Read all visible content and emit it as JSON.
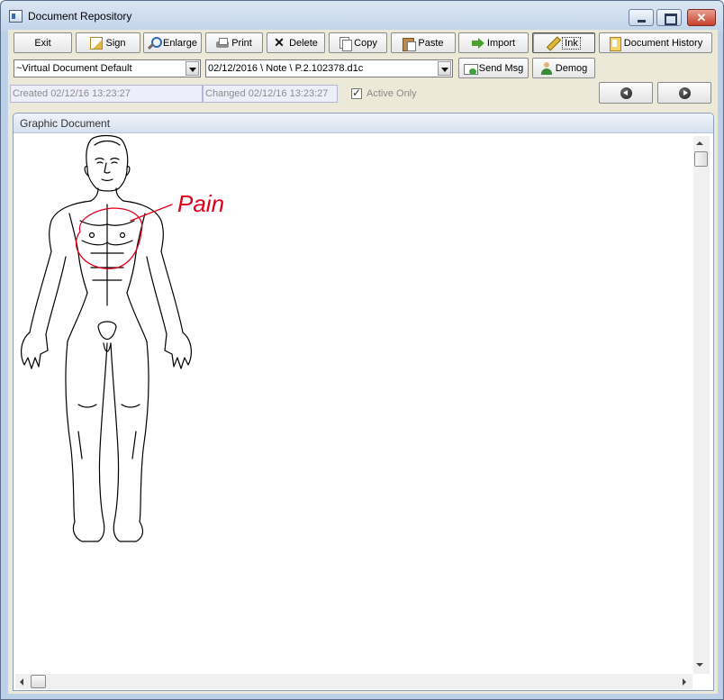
{
  "window": {
    "title": "Document Repository",
    "app_icon": "document-repository-icon"
  },
  "toolbar": {
    "exit": "Exit",
    "sign": "Sign",
    "enlarge": "Enlarge",
    "print": "Print",
    "delete": "Delete",
    "copy": "Copy",
    "paste": "Paste",
    "import": "Import",
    "ink": "Ink",
    "document_history": "Document History",
    "send_msg": "Send Msg",
    "demog": "Demog"
  },
  "selectors": {
    "template_value": "~Virtual Document Default",
    "document_value": "02/12/2016 \\ Note \\ P.2.102378.d1c"
  },
  "stamps": {
    "created": "Created 02/12/16 13:23:27",
    "changed": "Changed 02/12/16 13:23:27"
  },
  "filter": {
    "active_only_label": "Active Only",
    "active_only_checked": true
  },
  "panel": {
    "title": "Graphic Document"
  },
  "annotation": {
    "text": "Pain",
    "color": "#e0001b"
  },
  "colors": {
    "accent": "#2f6cc0",
    "ink": "#e0001b",
    "toolbar_bg": "#ece9d8"
  }
}
